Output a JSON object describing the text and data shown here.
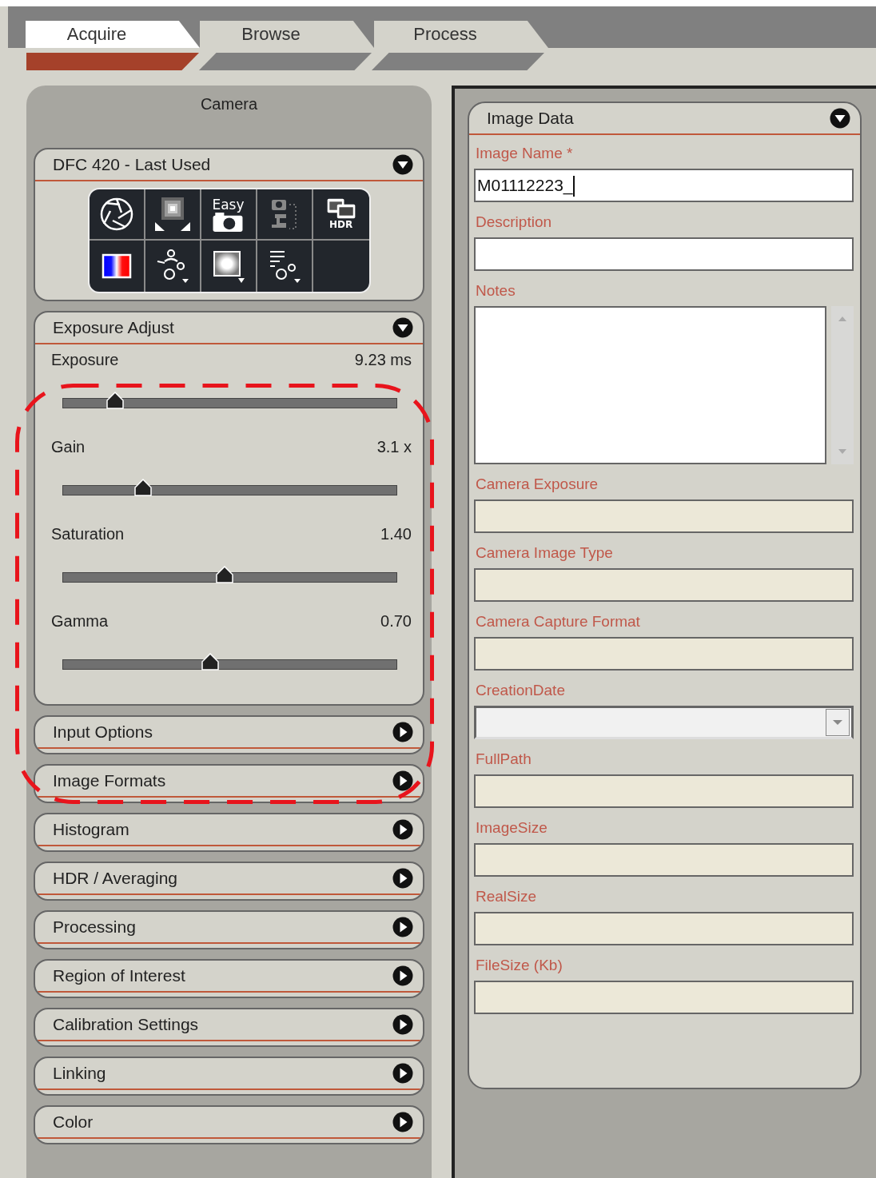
{
  "tabs": [
    {
      "label": "Acquire",
      "selected": true
    },
    {
      "label": "Browse",
      "selected": false
    },
    {
      "label": "Process",
      "selected": false
    }
  ],
  "left_panel": {
    "title": "Camera",
    "sections": [
      {
        "title": "DFC 420 - Last Used",
        "expanded": true,
        "kind": "toolbar",
        "tools": [
          {
            "kind": "aperture"
          },
          {
            "kind": "exposure"
          },
          {
            "kind": "easy",
            "label": "Easy"
          },
          {
            "kind": "microscope"
          },
          {
            "kind": "hdr",
            "label": "HDR"
          },
          {
            "kind": "color-bar"
          },
          {
            "kind": "user-gears"
          },
          {
            "kind": "white-frame"
          },
          {
            "kind": "list-gears"
          },
          {
            "kind": "empty"
          }
        ]
      },
      {
        "title": "Exposure Adjust",
        "expanded": true,
        "kind": "sliders",
        "sliders": [
          {
            "name": "Exposure",
            "reading": "9.23 ms",
            "level": 0.15
          },
          {
            "name": "Gain",
            "reading": "3.1 x",
            "level": 0.23
          },
          {
            "name": "Saturation",
            "reading": "1.40",
            "level": 0.46
          },
          {
            "name": "Gamma",
            "reading": "0.70",
            "level": 0.42
          }
        ]
      },
      {
        "title": "Input Options",
        "expanded": false
      },
      {
        "title": "Image Formats",
        "expanded": false
      },
      {
        "title": "Histogram",
        "expanded": false
      },
      {
        "title": "HDR / Averaging",
        "expanded": false
      },
      {
        "title": "Processing",
        "expanded": false
      },
      {
        "title": "Region of Interest",
        "expanded": false
      },
      {
        "title": "Calibration Settings",
        "expanded": false
      },
      {
        "title": "Linking",
        "expanded": false
      },
      {
        "title": "Color",
        "expanded": false
      }
    ]
  },
  "image_data": {
    "title": "Image Data",
    "expanded": true,
    "fields": [
      {
        "label": "Image Name  *",
        "kind": "text",
        "value": "M01112223_",
        "focused": true
      },
      {
        "label": "Description",
        "kind": "text",
        "focused": false
      },
      {
        "label": "Notes",
        "kind": "textarea",
        "focused": false
      },
      {
        "label": "Camera Exposure",
        "kind": "readonly"
      },
      {
        "label": "Camera Image Type",
        "kind": "readonly"
      },
      {
        "label": "Camera Capture Format",
        "kind": "readonly"
      },
      {
        "label": "CreationDate",
        "kind": "dropdown"
      },
      {
        "label": "FullPath",
        "kind": "readonly"
      },
      {
        "label": "ImageSize",
        "kind": "readonly"
      },
      {
        "label": "RealSize",
        "kind": "readonly"
      },
      {
        "label": "FileSize (Kb)",
        "kind": "readonly"
      }
    ]
  },
  "annotation": {
    "kind": "dashed-outline"
  }
}
